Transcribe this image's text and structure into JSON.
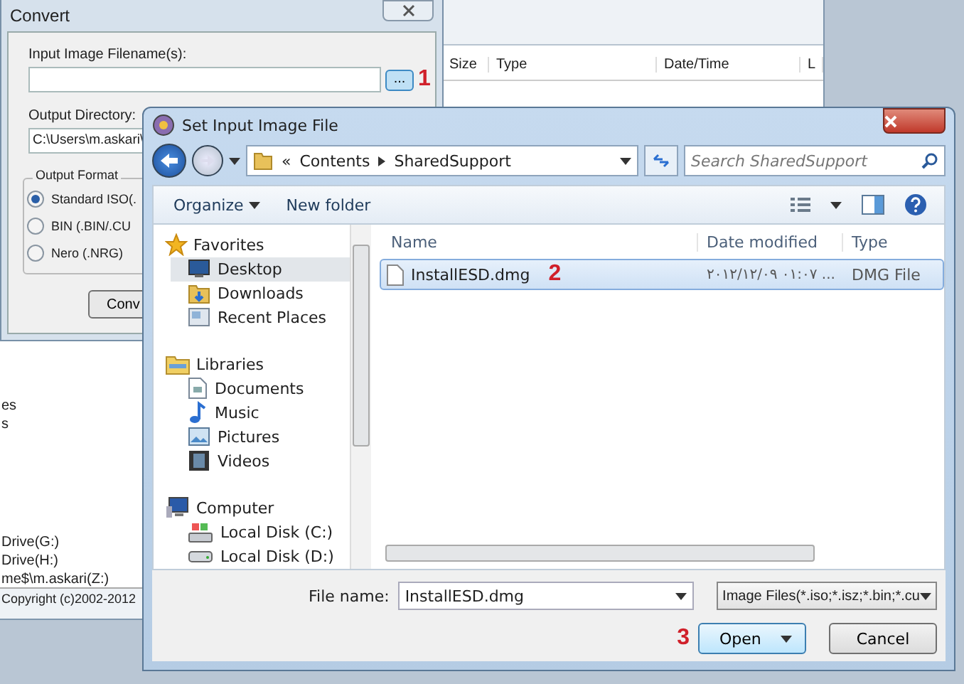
{
  "background_window": {
    "columns": [
      "Size",
      "Type",
      "Date/Time",
      "L"
    ],
    "drives": [
      "es",
      "s",
      "Drive(G:)",
      "Drive(H:)",
      "me$\\m.askari(Z:)"
    ],
    "status_text": "Copyright (c)2002-2012"
  },
  "convert_dialog": {
    "title": "Convert",
    "input_label": "Input Image Filename(s):",
    "browse_button": "...",
    "browse_annotation": "1",
    "output_label": "Output Directory:",
    "output_value": "C:\\Users\\m.askari\\",
    "format_group": "Output Format",
    "formats": [
      {
        "label": "Standard ISO(.",
        "selected": true
      },
      {
        "label": "BIN (.BIN/.CU",
        "selected": false
      },
      {
        "label": "Nero (.NRG)",
        "selected": false
      }
    ],
    "convert_button": "Conv"
  },
  "file_dialog": {
    "title": "Set Input Image File",
    "breadcrumb": [
      "«",
      "Contents",
      "SharedSupport"
    ],
    "search": {
      "placeholder": "Search SharedSupport"
    },
    "toolbar": [
      "Organize",
      "New folder"
    ],
    "nav": [
      {
        "label": "Favorites",
        "children": [
          {
            "label": "Desktop",
            "selected": true
          },
          {
            "label": "Downloads",
            "selected": false
          },
          {
            "label": "Recent Places",
            "selected": false
          }
        ]
      },
      {
        "label": "Libraries",
        "children": [
          {
            "label": "Documents",
            "selected": false
          },
          {
            "label": "Music",
            "selected": false
          },
          {
            "label": "Pictures",
            "selected": false
          },
          {
            "label": "Videos",
            "selected": false
          }
        ]
      },
      {
        "label": "Computer",
        "children": [
          {
            "label": "Local Disk (C:)",
            "selected": false
          },
          {
            "label": "Local Disk (D:)",
            "selected": false
          }
        ]
      }
    ],
    "columns": [
      "Name",
      "Date modified",
      "Type"
    ],
    "files": [
      {
        "name": "InstallESD.dmg",
        "annotation": "2",
        "date": "۲۰۱۲/۱۲/۰۹ ۰۱:۰۷ ...",
        "type": "DMG File",
        "selected": true
      }
    ],
    "file_name_label": "File name:",
    "file_name_value": "InstallESD.dmg",
    "filter": "Image Files(*.iso;*.isz;*.bin;*.cu",
    "open_annotation": "3",
    "open_button": "Open",
    "cancel_button": "Cancel"
  }
}
